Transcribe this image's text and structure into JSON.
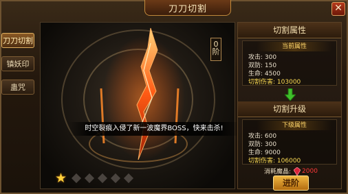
{
  "window": {
    "title": "刀刀切割",
    "close_glyph": "✕"
  },
  "tabs": [
    {
      "label": "刀刀切割",
      "active": true
    },
    {
      "label": "镇妖印",
      "active": false
    },
    {
      "label": "蛊咒",
      "active": false
    }
  ],
  "stage": {
    "level_text": "0阶",
    "notice": "时空裂痕入侵了新一波魔界BOSS，快来击杀!",
    "stars_lit": 1,
    "stars_total": 6
  },
  "cut_attributes": {
    "header": "切割属性",
    "subheader": "当前属性",
    "stats": [
      {
        "label": "攻击:",
        "value": "300"
      },
      {
        "label": "双防:",
        "value": "150"
      },
      {
        "label": "生命:",
        "value": "4500"
      },
      {
        "label": "切割伤害:",
        "value": "103000"
      }
    ]
  },
  "cut_upgrade": {
    "header": "切割升级",
    "subheader": "下级属性",
    "stats": [
      {
        "label": "攻击:",
        "value": "600"
      },
      {
        "label": "双防:",
        "value": "300"
      },
      {
        "label": "生命:",
        "value": "9000"
      },
      {
        "label": "切割伤害:",
        "value": "106000"
      }
    ]
  },
  "cost": {
    "label": "消耗魔晶:",
    "value": "2000"
  },
  "advance_button": "进阶",
  "colors": {
    "accent_gold": "#ffdd55",
    "arrow_green": "#3fbf2a",
    "cost_red": "#ff3838"
  }
}
